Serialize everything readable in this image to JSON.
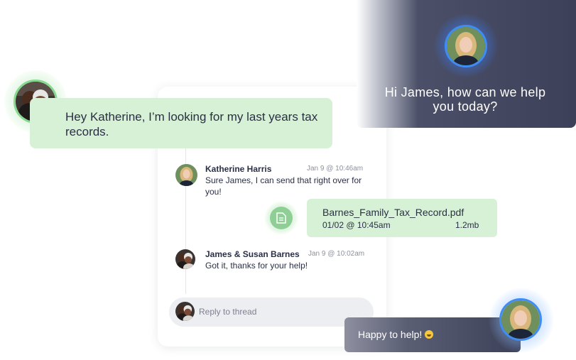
{
  "customer_message": {
    "text": "Hey Katherine, I’m looking for my last years tax records."
  },
  "agent_greeting": {
    "text": "Hi James, how can we help you today?"
  },
  "thread": {
    "messages": [
      {
        "author": "Katherine Harris",
        "time": "Jan 9 @ 10:46am",
        "text": "Sure James, I can send that right over for you!",
        "avatar": "woman-avatar"
      },
      {
        "author": "James & Susan Barnes",
        "time": "Jan 9 @ 10:02am",
        "text": "Got it, thanks for your help!",
        "avatar": "couple-avatar"
      }
    ],
    "attachment": {
      "filename": "Barnes_Family_Tax_Record.pdf",
      "date": "01/02 @ 10:45am",
      "size": "1.2mb",
      "icon": "document-icon"
    },
    "reply": {
      "placeholder": "Reply to thread"
    }
  },
  "agent_followup": {
    "text": "Happy to help!",
    "emoji": "grinning-face-icon"
  },
  "colors": {
    "green_bubble": "#d7f1d7",
    "dark_card": "#3c4058",
    "blue_ring": "#3f8df3",
    "green_ring": "#86d98f"
  }
}
